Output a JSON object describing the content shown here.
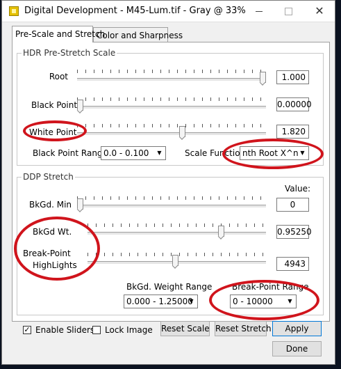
{
  "window": {
    "title": "Digital Development - M45-Lum.tif - Gray @ 33%",
    "minimize_glyph": "—",
    "maximize_glyph": "☐",
    "close_glyph": "✕"
  },
  "tabs": [
    {
      "label": "Pre-Scale and Stretch",
      "active": true
    },
    {
      "label": "Color and Sharpness",
      "active": false
    }
  ],
  "hdr": {
    "title": "HDR Pre-Stretch Scale",
    "root": {
      "label": "Root",
      "value": "1.000",
      "slider_level": 1.0
    },
    "black_point": {
      "label": "Black Point",
      "value": "0.00000",
      "slider_level": 0.0
    },
    "white_point": {
      "label": "White Point",
      "value": "1.820",
      "slider_level": 0.56
    },
    "black_point_range": {
      "label": "Black Point Range",
      "selected": "0.0 - 0.100"
    },
    "scale_function": {
      "label": "Scale Function",
      "selected": "nth Root X^n"
    }
  },
  "ddp": {
    "title": "DDP Stretch",
    "value_header": "Value:",
    "bkgd_min": {
      "label": "BkGd. Min",
      "value": "0",
      "slider_level": 0.0
    },
    "bkgd_wt": {
      "label": "BkGd Wt.",
      "value": "0.95250",
      "slider_level": 0.76
    },
    "break_point": {
      "label_line1": "Break-Point",
      "label_line2": "HighLights",
      "value": "4943",
      "slider_level": 0.49
    },
    "bkgd_weight_range": {
      "label": "BkGd. Weight Range",
      "selected": "0.000 - 1.25000"
    },
    "break_point_range": {
      "label": "Break-Point Range",
      "selected": "0 - 10000"
    }
  },
  "footer": {
    "enable_sliders": {
      "label": "Enable Sliders",
      "checked": true
    },
    "lock_image": {
      "label": "Lock Image",
      "checked": false
    },
    "reset_scale": "Reset Scale",
    "reset_stretch": "Reset Stretch",
    "apply": "Apply",
    "done": "Done"
  },
  "icons": {
    "dropdown_arrow": "▼",
    "check": "✓"
  },
  "colors": {
    "annotation": "#d0141c",
    "focus_border": "#0078d7"
  }
}
